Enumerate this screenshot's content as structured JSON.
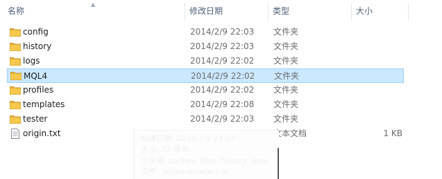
{
  "columns": {
    "name": "名称",
    "date_modified": "修改日期",
    "type": "类型",
    "size": "大小"
  },
  "files": [
    {
      "name": "config",
      "date": "2014/2/9 22:03",
      "type": "文件夹",
      "size": "",
      "kind": "folder",
      "selected": false
    },
    {
      "name": "history",
      "date": "2014/2/9 22:03",
      "type": "文件夹",
      "size": "",
      "kind": "folder",
      "selected": false
    },
    {
      "name": "logs",
      "date": "2014/2/9 22:02",
      "type": "文件夹",
      "size": "",
      "kind": "folder",
      "selected": false
    },
    {
      "name": "MQL4",
      "date": "2014/2/9 22:02",
      "type": "文件夹",
      "size": "",
      "kind": "folder",
      "selected": true
    },
    {
      "name": "profiles",
      "date": "2014/2/9 22:02",
      "type": "文件夹",
      "size": "",
      "kind": "folder",
      "selected": false
    },
    {
      "name": "templates",
      "date": "2014/2/9 22:08",
      "type": "文件夹",
      "size": "",
      "kind": "folder",
      "selected": false
    },
    {
      "name": "tester",
      "date": "2014/2/9 22:03",
      "type": "文件夹",
      "size": "",
      "kind": "folder",
      "selected": false
    },
    {
      "name": "origin.txt",
      "date": "2014/2/9 22:02",
      "type": "文本文档",
      "size": "1 KB",
      "kind": "text-file",
      "selected": false
    }
  ],
  "tooltip": {
    "lines": [
      "创建日期: 2014/2/9 22:02",
      "大小: 72 字节",
      "文件夹: caches, files, history, logs",
      "文件: lastparameters.ini"
    ]
  },
  "colors": {
    "selection_fill": "#cce8ff",
    "selection_border": "#99d1ff",
    "header_text": "#4c607a",
    "folder_yellow": "#f6c94c"
  },
  "icons": {
    "sort": "chevron-up-icon",
    "folder": "folder-icon",
    "file": "text-file-icon"
  }
}
